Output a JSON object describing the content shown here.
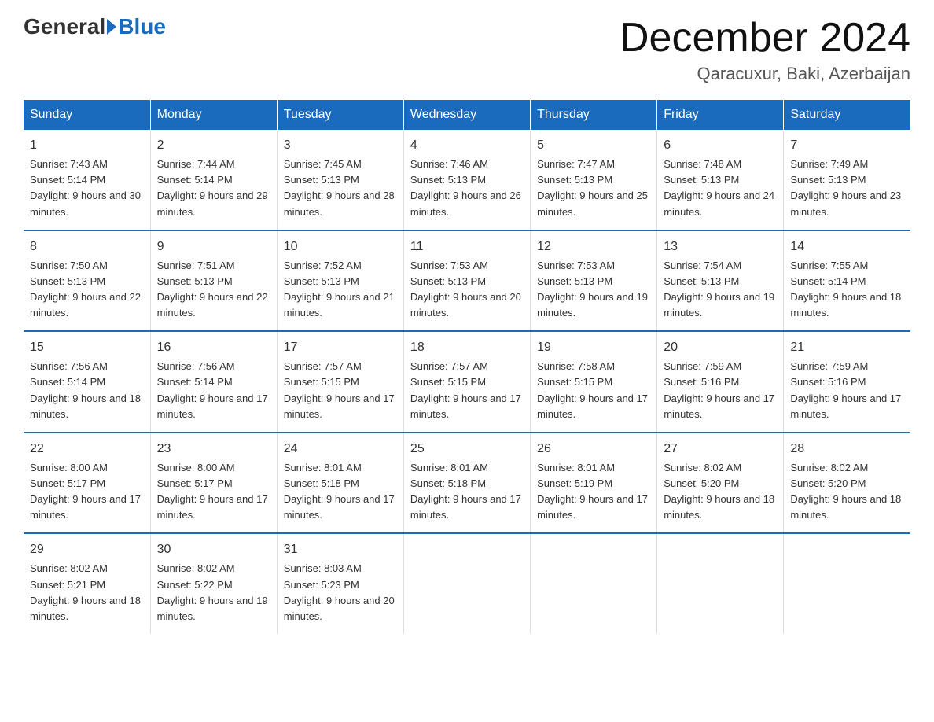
{
  "logo": {
    "general": "General",
    "blue": "Blue"
  },
  "title": "December 2024",
  "location": "Qaracuxur, Baki, Azerbaijan",
  "days_of_week": [
    "Sunday",
    "Monday",
    "Tuesday",
    "Wednesday",
    "Thursday",
    "Friday",
    "Saturday"
  ],
  "weeks": [
    [
      {
        "day": "1",
        "sunrise": "7:43 AM",
        "sunset": "5:14 PM",
        "daylight": "9 hours and 30 minutes."
      },
      {
        "day": "2",
        "sunrise": "7:44 AM",
        "sunset": "5:14 PM",
        "daylight": "9 hours and 29 minutes."
      },
      {
        "day": "3",
        "sunrise": "7:45 AM",
        "sunset": "5:13 PM",
        "daylight": "9 hours and 28 minutes."
      },
      {
        "day": "4",
        "sunrise": "7:46 AM",
        "sunset": "5:13 PM",
        "daylight": "9 hours and 26 minutes."
      },
      {
        "day": "5",
        "sunrise": "7:47 AM",
        "sunset": "5:13 PM",
        "daylight": "9 hours and 25 minutes."
      },
      {
        "day": "6",
        "sunrise": "7:48 AM",
        "sunset": "5:13 PM",
        "daylight": "9 hours and 24 minutes."
      },
      {
        "day": "7",
        "sunrise": "7:49 AM",
        "sunset": "5:13 PM",
        "daylight": "9 hours and 23 minutes."
      }
    ],
    [
      {
        "day": "8",
        "sunrise": "7:50 AM",
        "sunset": "5:13 PM",
        "daylight": "9 hours and 22 minutes."
      },
      {
        "day": "9",
        "sunrise": "7:51 AM",
        "sunset": "5:13 PM",
        "daylight": "9 hours and 22 minutes."
      },
      {
        "day": "10",
        "sunrise": "7:52 AM",
        "sunset": "5:13 PM",
        "daylight": "9 hours and 21 minutes."
      },
      {
        "day": "11",
        "sunrise": "7:53 AM",
        "sunset": "5:13 PM",
        "daylight": "9 hours and 20 minutes."
      },
      {
        "day": "12",
        "sunrise": "7:53 AM",
        "sunset": "5:13 PM",
        "daylight": "9 hours and 19 minutes."
      },
      {
        "day": "13",
        "sunrise": "7:54 AM",
        "sunset": "5:13 PM",
        "daylight": "9 hours and 19 minutes."
      },
      {
        "day": "14",
        "sunrise": "7:55 AM",
        "sunset": "5:14 PM",
        "daylight": "9 hours and 18 minutes."
      }
    ],
    [
      {
        "day": "15",
        "sunrise": "7:56 AM",
        "sunset": "5:14 PM",
        "daylight": "9 hours and 18 minutes."
      },
      {
        "day": "16",
        "sunrise": "7:56 AM",
        "sunset": "5:14 PM",
        "daylight": "9 hours and 17 minutes."
      },
      {
        "day": "17",
        "sunrise": "7:57 AM",
        "sunset": "5:15 PM",
        "daylight": "9 hours and 17 minutes."
      },
      {
        "day": "18",
        "sunrise": "7:57 AM",
        "sunset": "5:15 PM",
        "daylight": "9 hours and 17 minutes."
      },
      {
        "day": "19",
        "sunrise": "7:58 AM",
        "sunset": "5:15 PM",
        "daylight": "9 hours and 17 minutes."
      },
      {
        "day": "20",
        "sunrise": "7:59 AM",
        "sunset": "5:16 PM",
        "daylight": "9 hours and 17 minutes."
      },
      {
        "day": "21",
        "sunrise": "7:59 AM",
        "sunset": "5:16 PM",
        "daylight": "9 hours and 17 minutes."
      }
    ],
    [
      {
        "day": "22",
        "sunrise": "8:00 AM",
        "sunset": "5:17 PM",
        "daylight": "9 hours and 17 minutes."
      },
      {
        "day": "23",
        "sunrise": "8:00 AM",
        "sunset": "5:17 PM",
        "daylight": "9 hours and 17 minutes."
      },
      {
        "day": "24",
        "sunrise": "8:01 AM",
        "sunset": "5:18 PM",
        "daylight": "9 hours and 17 minutes."
      },
      {
        "day": "25",
        "sunrise": "8:01 AM",
        "sunset": "5:18 PM",
        "daylight": "9 hours and 17 minutes."
      },
      {
        "day": "26",
        "sunrise": "8:01 AM",
        "sunset": "5:19 PM",
        "daylight": "9 hours and 17 minutes."
      },
      {
        "day": "27",
        "sunrise": "8:02 AM",
        "sunset": "5:20 PM",
        "daylight": "9 hours and 18 minutes."
      },
      {
        "day": "28",
        "sunrise": "8:02 AM",
        "sunset": "5:20 PM",
        "daylight": "9 hours and 18 minutes."
      }
    ],
    [
      {
        "day": "29",
        "sunrise": "8:02 AM",
        "sunset": "5:21 PM",
        "daylight": "9 hours and 18 minutes."
      },
      {
        "day": "30",
        "sunrise": "8:02 AM",
        "sunset": "5:22 PM",
        "daylight": "9 hours and 19 minutes."
      },
      {
        "day": "31",
        "sunrise": "8:03 AM",
        "sunset": "5:23 PM",
        "daylight": "9 hours and 20 minutes."
      },
      null,
      null,
      null,
      null
    ]
  ]
}
